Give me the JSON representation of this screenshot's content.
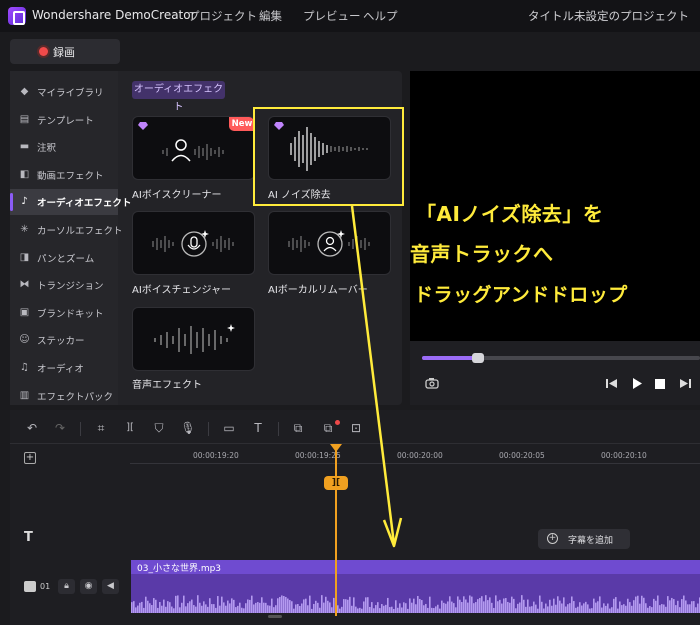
{
  "titlebar": {
    "app_name": "Wondershare DemoCreator",
    "menu": [
      "プロジェクト",
      "編集",
      "プレビュー",
      "ヘルプ"
    ],
    "project_title": "タイトル未設定のプロジェクト"
  },
  "record": {
    "label": "録画"
  },
  "sidebar": {
    "items": [
      {
        "label": "マイライブラリ",
        "icon": "library-icon"
      },
      {
        "label": "テンプレート",
        "icon": "template-icon"
      },
      {
        "label": "注釈",
        "icon": "annotation-icon"
      },
      {
        "label": "動画エフェクト",
        "icon": "video-effect-icon"
      },
      {
        "label": "オーディオエフェクト",
        "icon": "music-note-icon",
        "active": true
      },
      {
        "label": "カーソルエフェクト",
        "icon": "cursor-icon"
      },
      {
        "label": "パンとズーム",
        "icon": "pan-zoom-icon"
      },
      {
        "label": "トランジション",
        "icon": "transition-icon"
      },
      {
        "label": "ブランドキット",
        "icon": "brand-kit-icon"
      },
      {
        "label": "ステッカー",
        "icon": "sticker-icon"
      },
      {
        "label": "オーディオ",
        "icon": "audio-icon"
      },
      {
        "label": "エフェクトパック",
        "icon": "effect-pack-icon"
      }
    ]
  },
  "effects": {
    "category": "オーディオエフェクト",
    "cards": [
      {
        "label": "AIボイスクリーナー",
        "badge": "New"
      },
      {
        "label": "AI ノイズ除去"
      },
      {
        "label": "AIボイスチェンジャー"
      },
      {
        "label": "AIボーカルリムーバー"
      },
      {
        "label": "音声エフェクト"
      }
    ]
  },
  "overlay": {
    "line1": "「AIノイズ除去」を",
    "line2": "音声トラックへ",
    "line3": "ドラッグアンドドロップ",
    "color": "#ffeb3b"
  },
  "preview": {
    "progress": 0.2
  },
  "timeline": {
    "ticks": [
      "00:00:19:20",
      "00:00:19:25",
      "00:00:20:00",
      "00:00:20:05",
      "00:00:20:10"
    ],
    "add_caption": "字幕を追加",
    "audio_clip": "03_小さな世界.mp3",
    "track_number": "01"
  },
  "colors": {
    "accent": "#8b5cf6",
    "playhead": "#f0a020",
    "record": "#f04a4a"
  }
}
